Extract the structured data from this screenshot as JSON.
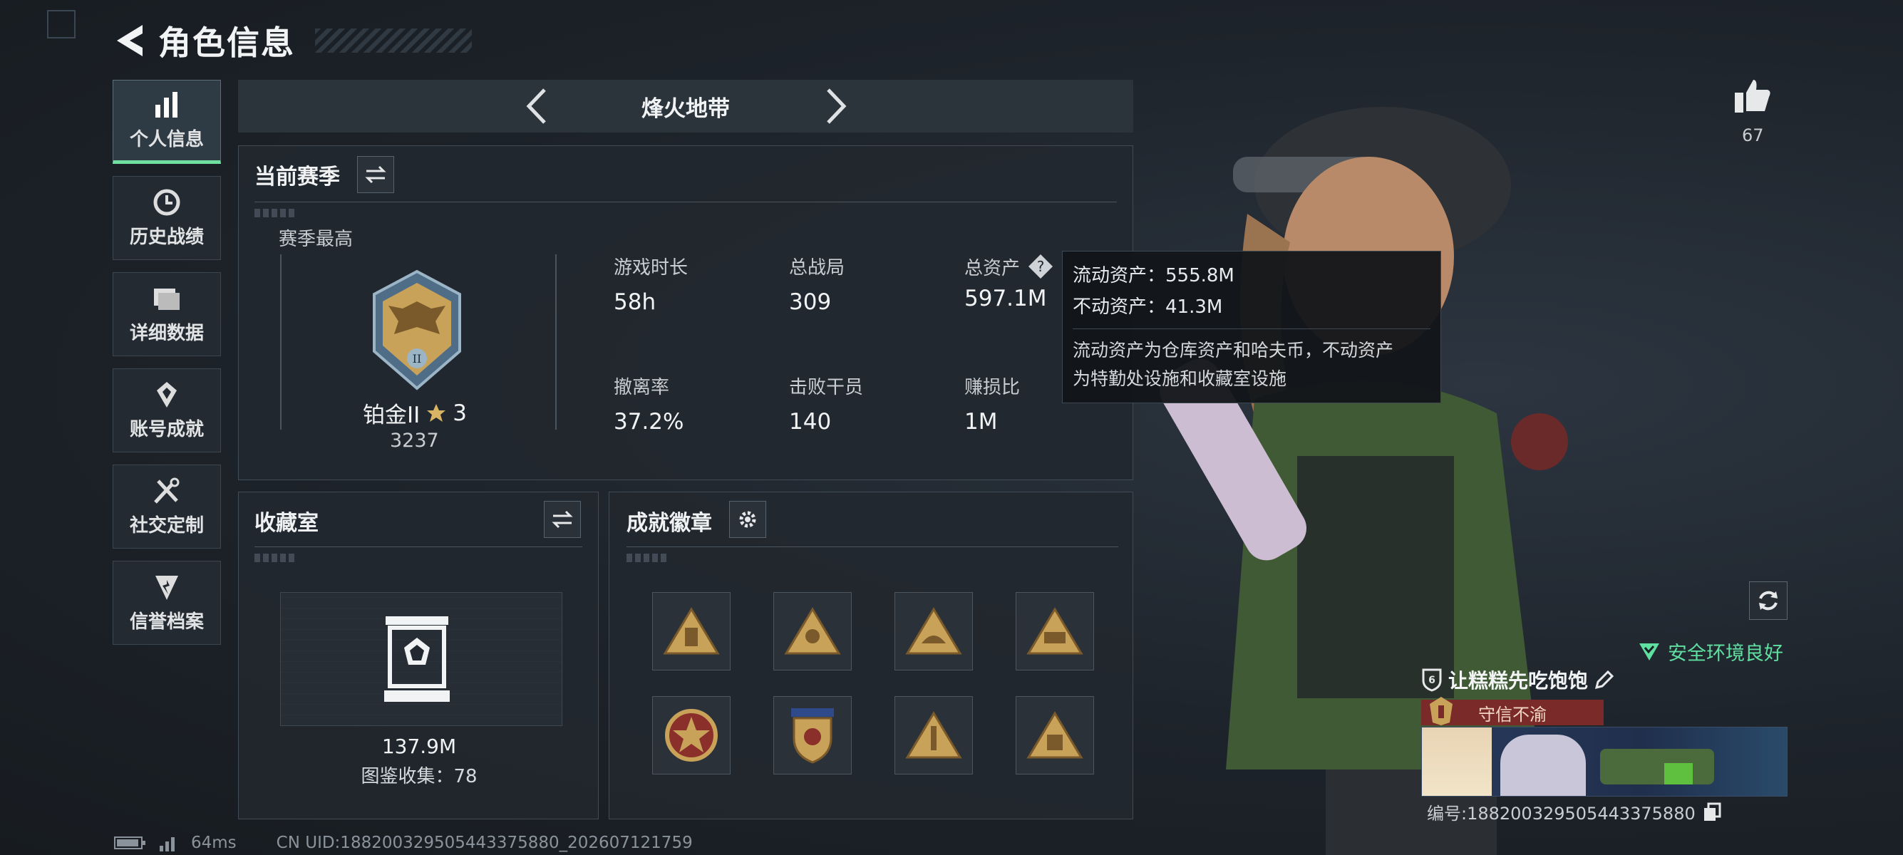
{
  "header": {
    "title": "角色信息"
  },
  "nav": {
    "items": [
      {
        "label": "个人信息",
        "icon": "bar-chart-icon",
        "active": true
      },
      {
        "label": "历史战绩",
        "icon": "history-clock-icon"
      },
      {
        "label": "详细数据",
        "icon": "folder-icon"
      },
      {
        "label": "账号成就",
        "icon": "achievement-icon"
      },
      {
        "label": "社交定制",
        "icon": "tools-icon"
      },
      {
        "label": "信誉档案",
        "icon": "reputation-icon"
      }
    ]
  },
  "mode": {
    "title": "烽火地带"
  },
  "season": {
    "title": "当前赛季",
    "best_label": "赛季最高",
    "rank_name": "铂金II",
    "rank_stars": "3",
    "rank_score": "3237",
    "stats": [
      {
        "label": "游戏时长",
        "value": "58h"
      },
      {
        "label": "总战局",
        "value": "309"
      },
      {
        "label": "总资产",
        "value": "597.1M"
      },
      {
        "label": "撤离率",
        "value": "37.2%"
      },
      {
        "label": "击败干员",
        "value": "140"
      },
      {
        "label": "赚损比",
        "value": "1M"
      }
    ]
  },
  "tooltip": {
    "liquid": "流动资产：555.8M",
    "fixed": "不动资产：41.3M",
    "desc_line1": "流动资产为仓库资产和哈夫币，不动资产",
    "desc_line2": "为特勤处设施和收藏室设施"
  },
  "collection": {
    "title": "收藏室",
    "value": "137.9M",
    "count": "图鉴收集：78"
  },
  "badges": {
    "title": "成就徽章",
    "items": [
      "badge-1",
      "badge-2",
      "badge-3",
      "badge-4",
      "badge-5",
      "badge-6",
      "badge-7",
      "badge-8"
    ]
  },
  "profile": {
    "likes": "67",
    "safe_status": "安全环境良好",
    "player_name": "让糕糕先吃饱饱",
    "honor_title": "守信不渝",
    "player_id": "编号:188200329505443375880"
  },
  "footer": {
    "ping": "64ms",
    "uid": "CN UID:188200329505443375880_202607121759"
  },
  "colors": {
    "accent_green": "#5fe0a0",
    "honor_red": "#7a2a28",
    "gold": "#c9a25a"
  }
}
